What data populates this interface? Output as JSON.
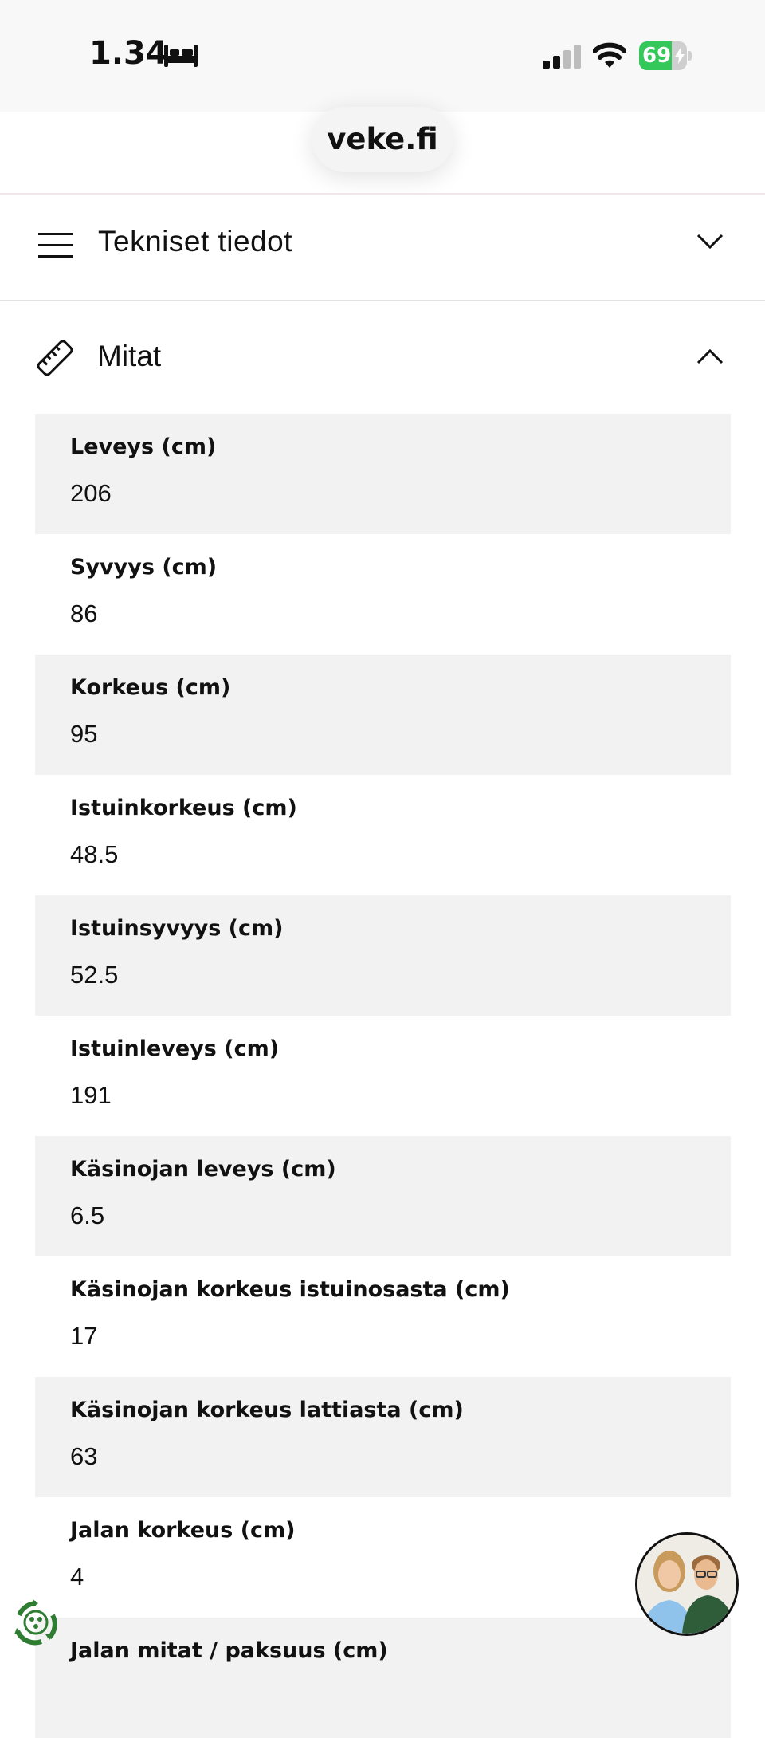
{
  "status_bar": {
    "time": "1.34",
    "battery_level": "69",
    "battery_percent": 69,
    "icons": [
      "bed-icon",
      "cellular-signal-icon",
      "wifi-icon",
      "battery-charging-icon"
    ]
  },
  "browser": {
    "url": "veke.fi"
  },
  "section": {
    "title": "Tekniset tiedot",
    "expanded": false
  },
  "dimensions": {
    "title": "Mitat",
    "expanded": true,
    "items": [
      {
        "label": "Leveys (cm)",
        "value": "206"
      },
      {
        "label": "Syvyys (cm)",
        "value": "86"
      },
      {
        "label": "Korkeus (cm)",
        "value": "95"
      },
      {
        "label": "Istuinkorkeus (cm)",
        "value": "48.5"
      },
      {
        "label": "Istuinsyvyys (cm)",
        "value": "52.5"
      },
      {
        "label": "Istuinleveys (cm)",
        "value": "191"
      },
      {
        "label": "Käsinojan leveys (cm)",
        "value": "6.5"
      },
      {
        "label": "Käsinojan korkeus istuinosasta (cm)",
        "value": "17"
      },
      {
        "label": "Käsinojan korkeus lattiasta (cm)",
        "value": "63"
      },
      {
        "label": "Jalan korkeus (cm)",
        "value": "4"
      },
      {
        "label": "Jalan mitat / paksuus (cm)",
        "value": ""
      }
    ]
  },
  "colors": {
    "accent_green": "#34c759",
    "veke_green": "#2e7d32",
    "row_shade": "#f2f2f2"
  }
}
